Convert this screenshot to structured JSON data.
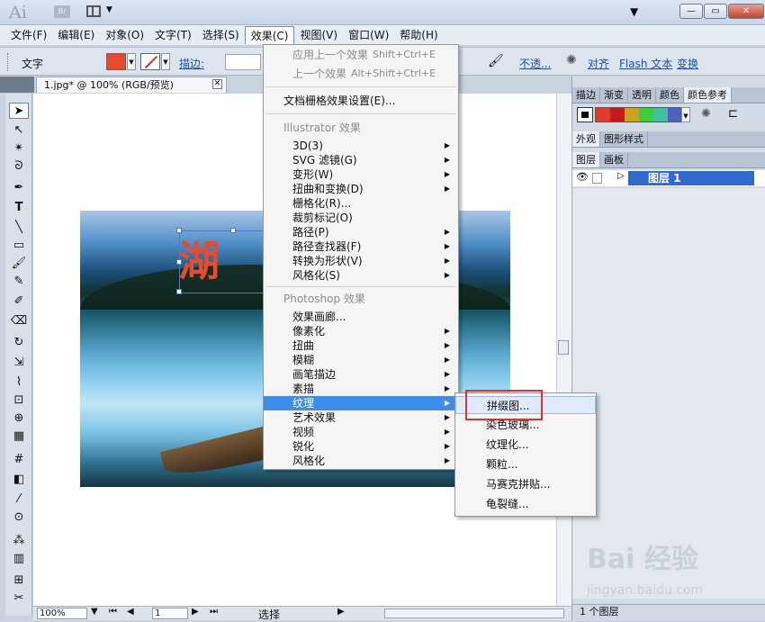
{
  "app": {
    "logo": "Ai",
    "bridge": "Br"
  },
  "menubar": [
    "文件(F)",
    "编辑(E)",
    "对象(O)",
    "文字(T)",
    "选择(S)",
    "效果(C)",
    "视图(V)",
    "窗口(W)",
    "帮助(H)"
  ],
  "control": {
    "label": "文字",
    "stroke_label": "描边:",
    "opacity": "不透...",
    "align": "对齐",
    "flash": "Flash 文本",
    "transform": "变换"
  },
  "document": {
    "tab": "1.jpg* @ 100% (RGB/预览)",
    "canvas_text": "湖"
  },
  "effect_menu": {
    "items": [
      {
        "label": "应用上一个效果",
        "shortcut": "Shift+Ctrl+E",
        "disabled": true
      },
      {
        "label": "上一个效果",
        "shortcut": "Alt+Shift+Ctrl+E",
        "disabled": true
      },
      {
        "label": "文档栅格效果设置(E)..."
      },
      {
        "label": "Illustrator 效果"
      },
      {
        "label": "3D(3)"
      },
      {
        "label": "SVG 滤镜(G)"
      },
      {
        "label": "变形(W)"
      },
      {
        "label": "扭曲和变换(D)"
      },
      {
        "label": "栅格化(R)..."
      },
      {
        "label": "裁剪标记(O)"
      },
      {
        "label": "路径(P)"
      },
      {
        "label": "路径查找器(F)"
      },
      {
        "label": "转换为形状(V)"
      },
      {
        "label": "风格化(S)"
      },
      {
        "label": "Photoshop 效果"
      },
      {
        "label": "效果画廊..."
      },
      {
        "label": "像素化"
      },
      {
        "label": "扭曲"
      },
      {
        "label": "模糊"
      },
      {
        "label": "画笔描边"
      },
      {
        "label": "素描"
      },
      {
        "label": "纹理"
      },
      {
        "label": "艺术效果"
      },
      {
        "label": "视频"
      },
      {
        "label": "锐化"
      },
      {
        "label": "风格化"
      }
    ]
  },
  "texture_submenu": [
    "拼缀图...",
    "染色玻璃...",
    "纹理化...",
    "颗粒...",
    "马赛克拼贴...",
    "龟裂缝..."
  ],
  "panels": {
    "top_tabs": [
      "描边",
      "渐变",
      "透明",
      "颜色",
      "颜色参考"
    ],
    "mid_tabs": [
      "外观",
      "图形样式"
    ],
    "layer_tabs": [
      "图层",
      "画板"
    ],
    "layer_name": "图层 1",
    "layer_count": "1 个图层",
    "swatches": [
      "#e03a2a",
      "#c21c1c",
      "#d0a020",
      "#3fcc40",
      "#40c0a0",
      "#5060c0",
      "#7a3ab0"
    ]
  },
  "status": {
    "zoom": "100%",
    "page": "1",
    "mode": "选择"
  },
  "watermark": {
    "logo": "Bai 经验",
    "url": "jingyan.baidu.com"
  }
}
